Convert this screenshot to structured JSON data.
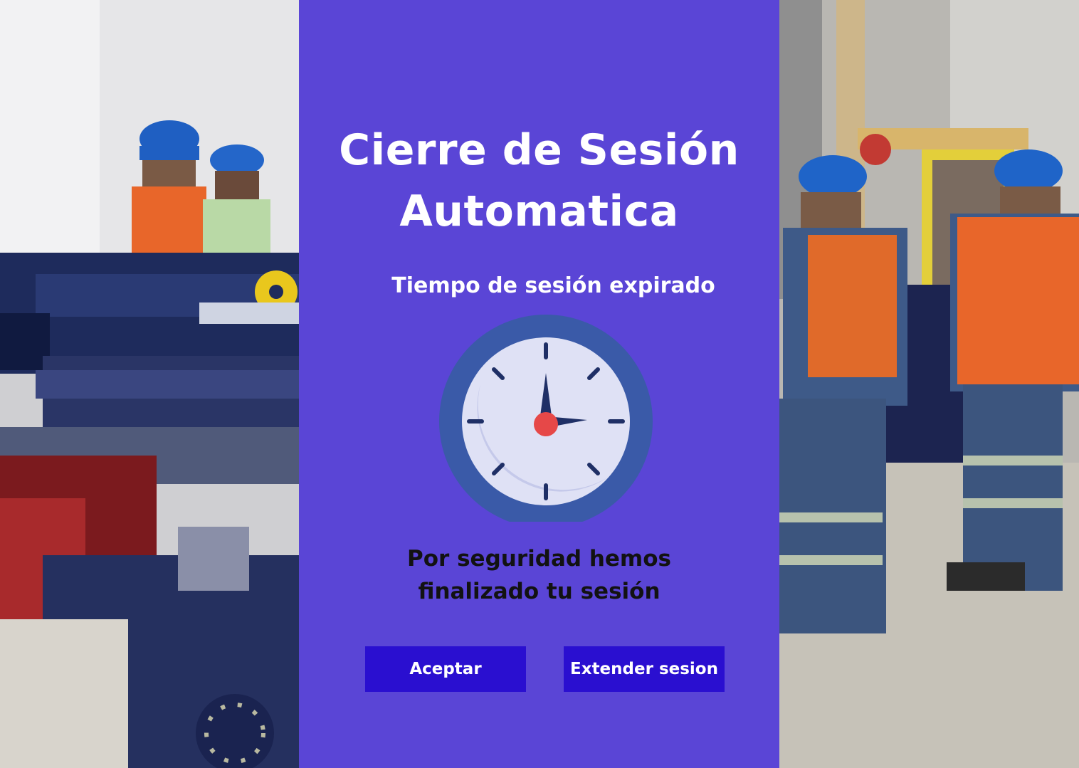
{
  "dialog": {
    "title": "Cierre de Sesión Automatica",
    "subtitle": "Tiempo de sesión expirado",
    "icon": "clock-icon",
    "message": "Por seguridad hemos finalizado tu sesión",
    "buttons": {
      "accept_label": "Aceptar",
      "extend_label": "Extender sesion"
    }
  },
  "colors": {
    "panel_background": "#5a45d6",
    "button_background": "#2a0fd0",
    "title_text": "#ffffff",
    "message_text": "#121212"
  },
  "background": {
    "left_image": "industrial-workers-photo",
    "right_image": "industrial-workers-photo"
  }
}
